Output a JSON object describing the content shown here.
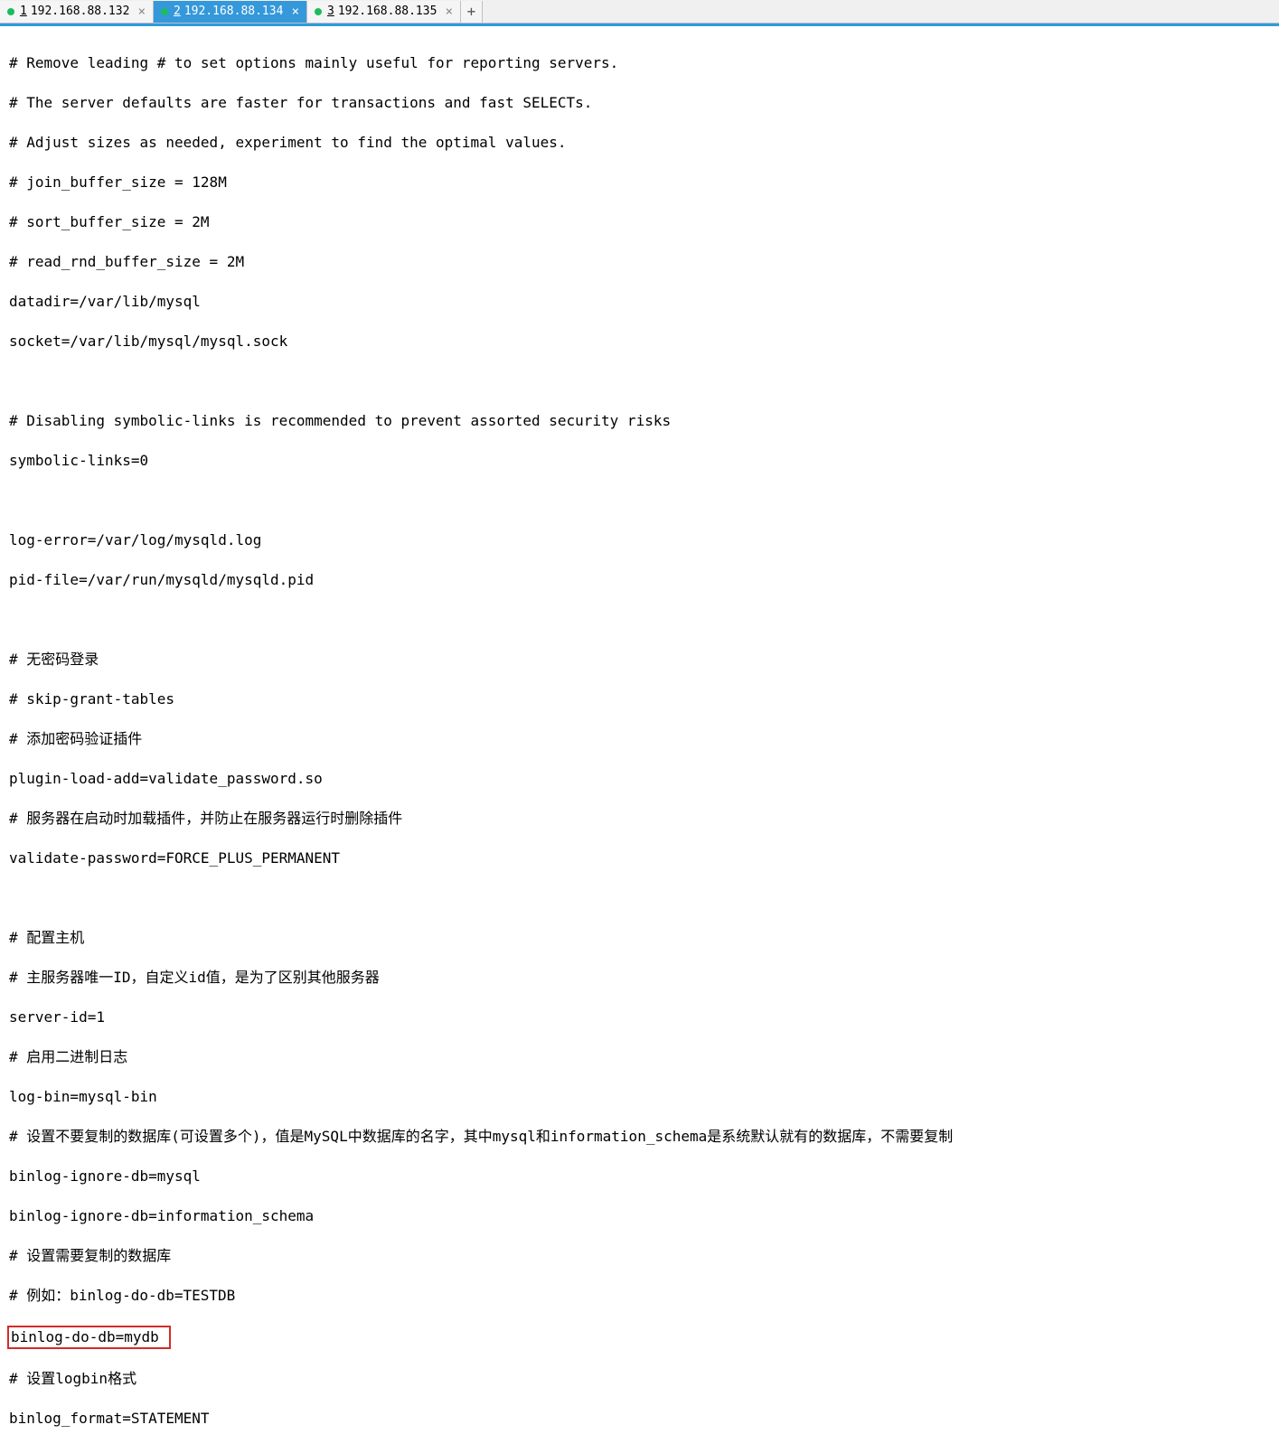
{
  "tabs": [
    {
      "num": "1",
      "label": "192.168.88.132",
      "active": false
    },
    {
      "num": "2",
      "label": "192.168.88.134",
      "active": true
    },
    {
      "num": "3",
      "label": "192.168.88.135",
      "active": false
    }
  ],
  "add_tab": "+",
  "close_glyph": "×",
  "lines": {
    "l0": "# Remove leading # to set options mainly useful for reporting servers.",
    "l1": "# The server defaults are faster for transactions and fast SELECTs.",
    "l2": "# Adjust sizes as needed, experiment to find the optimal values.",
    "l3": "# join_buffer_size = 128M",
    "l4": "# sort_buffer_size = 2M",
    "l5": "# read_rnd_buffer_size = 2M",
    "l6": "datadir=/var/lib/mysql",
    "l7": "socket=/var/lib/mysql/mysql.sock",
    "l8": "# Disabling symbolic-links is recommended to prevent assorted security risks",
    "l9": "symbolic-links=0",
    "l10": "log-error=/var/log/mysqld.log",
    "l11": "pid-file=/var/run/mysqld/mysqld.pid",
    "l12": "# 无密码登录",
    "l13": "# skip-grant-tables",
    "l14": "# 添加密码验证插件",
    "l15": "plugin-load-add=validate_password.so",
    "l16": "# 服务器在启动时加载插件，并防止在服务器运行时删除插件",
    "l17": "validate-password=FORCE_PLUS_PERMANENT",
    "l18": "# 配置主机",
    "l19": "# 主服务器唯一ID，自定义id值，是为了区别其他服务器",
    "l20": "server-id=1",
    "l21": "# 启用二进制日志",
    "l22": "log-bin=mysql-bin",
    "l23": "# 设置不要复制的数据库(可设置多个)，值是MySQL中数据库的名字，其中mysql和information_schema是系统默认就有的数据库，不需要复制",
    "l24": "binlog-ignore-db=mysql",
    "l25": "binlog-ignore-db=information_schema",
    "l26": "# 设置需要复制的数据库",
    "l27": "# 例如：binlog-do-db=TESTDB",
    "l28": "binlog-do-db=mydb ",
    "l29": "# 设置logbin格式",
    "l30": "binlog_format=STATEMENT"
  }
}
